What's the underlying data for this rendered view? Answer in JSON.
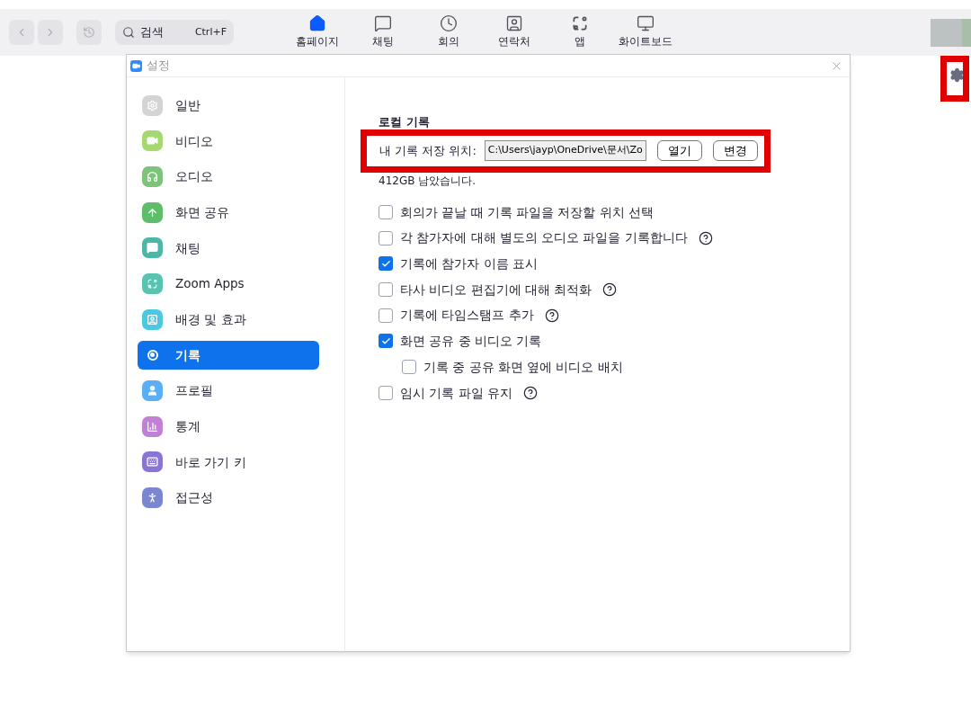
{
  "toolbar": {
    "search": {
      "placeholder": "검색",
      "shortcut": "Ctrl+F"
    },
    "nav": [
      {
        "label": "홈페이지",
        "kind": "home",
        "selected": true
      },
      {
        "label": "채팅",
        "kind": "chat",
        "selected": false
      },
      {
        "label": "회의",
        "kind": "clock",
        "selected": false
      },
      {
        "label": "연락처",
        "kind": "contact",
        "selected": false
      },
      {
        "label": "앱",
        "kind": "apps",
        "selected": false
      },
      {
        "label": "화이트보드",
        "kind": "whiteboard",
        "selected": false
      }
    ]
  },
  "dialog": {
    "title": "설정",
    "sidebar": {
      "items": [
        {
          "label": "일반",
          "kind": "gear",
          "color": "#d4d4d4",
          "selected": false
        },
        {
          "label": "비디오",
          "kind": "video",
          "color": "#a5d86e",
          "selected": false
        },
        {
          "label": "오디오",
          "kind": "headphones",
          "color": "#7cc47a",
          "selected": false
        },
        {
          "label": "화면 공유",
          "kind": "share",
          "color": "#5dbd68",
          "selected": false
        },
        {
          "label": "채팅",
          "kind": "chat",
          "color": "#4db6a4",
          "selected": false
        },
        {
          "label": "Zoom Apps",
          "kind": "apps",
          "color": "#59c2b0",
          "selected": false
        },
        {
          "label": "배경 및 효과",
          "kind": "background",
          "color": "#4cc9e0",
          "selected": false
        },
        {
          "label": "기록",
          "kind": "record",
          "color": "#0e72ed",
          "selected": true
        },
        {
          "label": "프로필",
          "kind": "profile",
          "color": "#5aaef5",
          "selected": false
        },
        {
          "label": "통계",
          "kind": "stats",
          "color": "#c17fd6",
          "selected": false
        },
        {
          "label": "바로 가기 키",
          "kind": "keyboard",
          "color": "#8a74d4",
          "selected": false
        },
        {
          "label": "접근성",
          "kind": "accessibility",
          "color": "#7b86d0",
          "selected": false
        }
      ]
    },
    "section": {
      "title": "로컬 기록",
      "location_label": "내 기록 저장 위치:",
      "location_value": "C:\\Users\\jayp\\OneDrive\\문서\\Zo",
      "buttons": [
        "열기",
        "변경"
      ],
      "free_space": "412GB 남았습니다."
    },
    "options": [
      {
        "label": "회의가 끝날 때 기록 파일을 저장할 위치 선택",
        "checked": false,
        "help": false
      },
      {
        "label": "각 참가자에 대해 별도의 오디오 파일을 기록합니다",
        "checked": false,
        "help": true
      },
      {
        "label": "기록에 참가자 이름 표시",
        "checked": true,
        "help": false
      },
      {
        "label": "타사 비디오 편집기에 대해 최적화",
        "checked": false,
        "help": true
      },
      {
        "label": "기록에 타임스탬프 추가",
        "checked": false,
        "help": true
      },
      {
        "label": "화면 공유 중 비디오 기록",
        "checked": true,
        "help": false,
        "children": [
          {
            "label": "기록 중 공유 화면 옆에 비디오 배치",
            "checked": false,
            "help": false
          }
        ]
      },
      {
        "label": "임시 기록 파일 유지",
        "checked": false,
        "help": true
      }
    ]
  }
}
